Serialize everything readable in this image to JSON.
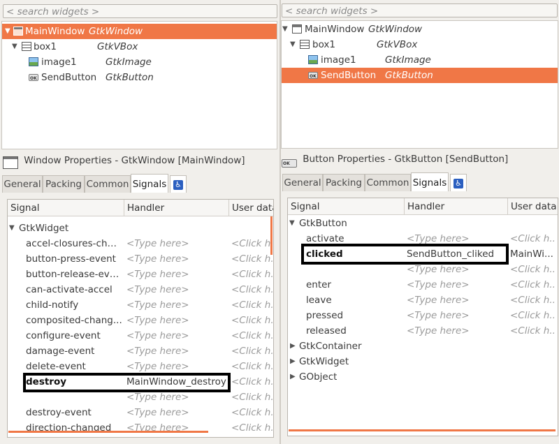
{
  "left": {
    "search_placeholder": "< search widgets >",
    "tree": [
      {
        "name": "MainWindow",
        "type": "GtkWindow",
        "icon": "window-icon",
        "selected": true
      },
      {
        "name": "box1",
        "type": "GtkVBox",
        "icon": "vbox-icon",
        "selected": false
      },
      {
        "name": "image1",
        "type": "GtkImage",
        "icon": "image-icon",
        "selected": false
      },
      {
        "name": "SendButton",
        "type": "GtkButton",
        "icon": "button-icon",
        "selected": false
      }
    ],
    "props_title": "Window Properties - GtkWindow [MainWindow]",
    "tabs": [
      "General",
      "Packing",
      "Common",
      "Signals"
    ],
    "active_tab": "Signals",
    "columns": [
      "Signal",
      "Handler",
      "User data"
    ],
    "group": "GtkWidget",
    "signals": [
      {
        "signal": "accel-closures-chan...",
        "handler": "<Type here>",
        "user": "<Click h..."
      },
      {
        "signal": "button-press-event",
        "handler": "<Type here>",
        "user": "<Click h..."
      },
      {
        "signal": "button-release-event",
        "handler": "<Type here>",
        "user": "<Click h..."
      },
      {
        "signal": "can-activate-accel",
        "handler": "<Type here>",
        "user": "<Click h..."
      },
      {
        "signal": "child-notify",
        "handler": "<Type here>",
        "user": "<Click h..."
      },
      {
        "signal": "composited-chang...",
        "handler": "<Type here>",
        "user": "<Click h..."
      },
      {
        "signal": "configure-event",
        "handler": "<Type here>",
        "user": "<Click h..."
      },
      {
        "signal": "damage-event",
        "handler": "<Type here>",
        "user": "<Click h..."
      },
      {
        "signal": "delete-event",
        "handler": "<Type here>",
        "user": "<Click h..."
      },
      {
        "signal": "destroy",
        "handler": "MainWindow_destroy",
        "user": "<Click h..."
      },
      {
        "signal": "",
        "handler": "<Type here>",
        "user": "<Click h..."
      },
      {
        "signal": "destroy-event",
        "handler": "<Type here>",
        "user": "<Click h..."
      },
      {
        "signal": "direction-changed",
        "handler": "<Type here>",
        "user": "<Click h..."
      }
    ]
  },
  "right": {
    "search_placeholder": "< search widgets >",
    "tree": [
      {
        "name": "MainWindow",
        "type": "GtkWindow",
        "icon": "window-icon",
        "selected": false
      },
      {
        "name": "box1",
        "type": "GtkVBox",
        "icon": "vbox-icon",
        "selected": false
      },
      {
        "name": "image1",
        "type": "GtkImage",
        "icon": "image-icon",
        "selected": false
      },
      {
        "name": "SendButton",
        "type": "GtkButton",
        "icon": "button-icon",
        "selected": true
      }
    ],
    "props_title": "Button Properties - GtkButton [SendButton]",
    "tabs": [
      "General",
      "Packing",
      "Common",
      "Signals"
    ],
    "active_tab": "Signals",
    "columns": [
      "Signal",
      "Handler",
      "User data"
    ],
    "group": "GtkButton",
    "signals": [
      {
        "signal": "activate",
        "handler": "<Type here>",
        "user": "<Click h..."
      },
      {
        "signal": "clicked",
        "handler": "SendButton_cliked",
        "user": "MainWi..."
      },
      {
        "signal": "",
        "handler": "<Type here>",
        "user": "<Click h..."
      },
      {
        "signal": "enter",
        "handler": "<Type here>",
        "user": "<Click h..."
      },
      {
        "signal": "leave",
        "handler": "<Type here>",
        "user": "<Click h..."
      },
      {
        "signal": "pressed",
        "handler": "<Type here>",
        "user": "<Click h..."
      },
      {
        "signal": "released",
        "handler": "<Type here>",
        "user": "<Click h..."
      }
    ],
    "collapsed_groups": [
      "GtkContainer",
      "GtkWidget",
      "GObject"
    ]
  },
  "colors": {
    "selection": "#f07746",
    "highlight_box": "#000000"
  }
}
